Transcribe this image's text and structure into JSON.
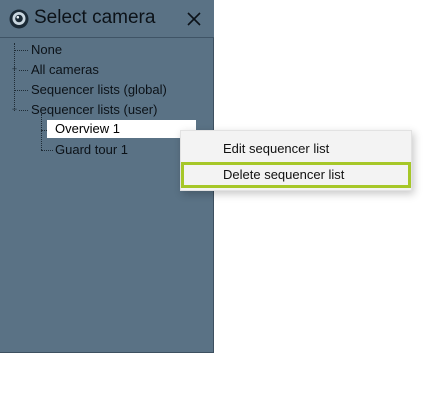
{
  "window": {
    "title": "Select camera",
    "icon": "camera-icon",
    "close_icon": "close-icon"
  },
  "tree": {
    "items": [
      {
        "label": "None"
      },
      {
        "label": "All cameras"
      },
      {
        "label": "Sequencer lists (global)"
      },
      {
        "label": "Sequencer lists (user)"
      },
      {
        "label": "Overview 1",
        "selected": true
      },
      {
        "label": "Guard tour 1"
      }
    ]
  },
  "context_menu": {
    "items": [
      {
        "label": "Edit sequencer list"
      },
      {
        "label": "Delete sequencer list",
        "highlighted": true
      }
    ]
  },
  "colors": {
    "panel_bg": "#5a7285",
    "highlight_border": "#a6c728",
    "menu_bg": "#f3f3f3"
  }
}
